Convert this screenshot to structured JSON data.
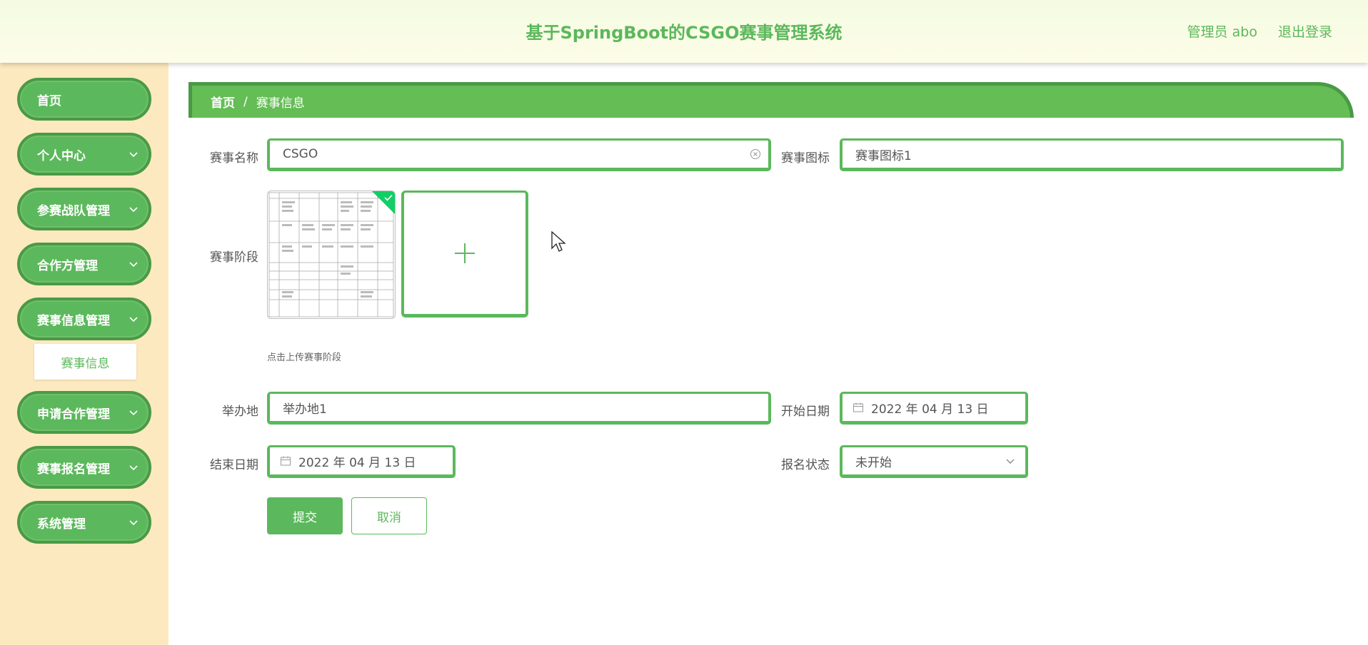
{
  "header": {
    "title": "基于SpringBoot的CSGO赛事管理系统",
    "user": "管理员 abo",
    "logout": "退出登录"
  },
  "sidebar": {
    "items": [
      {
        "label": "首页",
        "has_children": false
      },
      {
        "label": "个人中心",
        "has_children": true
      },
      {
        "label": "参赛战队管理",
        "has_children": true
      },
      {
        "label": "合作方管理",
        "has_children": true
      },
      {
        "label": "赛事信息管理",
        "has_children": true
      },
      {
        "label": "申请合作管理",
        "has_children": true
      },
      {
        "label": "赛事报名管理",
        "has_children": true
      },
      {
        "label": "系统管理",
        "has_children": true
      }
    ],
    "active_submenu": "赛事信息"
  },
  "breadcrumb": {
    "home": "首页",
    "separator": "/",
    "current": "赛事信息"
  },
  "form": {
    "name_label": "赛事名称",
    "name_value": "CSGO",
    "icon_label": "赛事图标",
    "icon_value": "赛事图标1",
    "stage_label": "赛事阶段",
    "upload_hint": "点击上传赛事阶段",
    "venue_label": "举办地",
    "venue_value": "举办地1",
    "start_label": "开始日期",
    "start_value": "2022 年 04 月 13 日",
    "end_label": "结束日期",
    "end_value": "2022 年 04 月 13 日",
    "status_label": "报名状态",
    "status_value": "未开始",
    "submit": "提交",
    "cancel": "取消"
  },
  "colors": {
    "primary": "#5cb85c",
    "sidebar_bg": "#fde9bf",
    "success_badge": "#13ce66"
  },
  "icons": {
    "clear": "circle-close-icon",
    "calendar": "calendar-icon",
    "dropdown": "chevron-down-icon",
    "upload": "plus-icon"
  }
}
